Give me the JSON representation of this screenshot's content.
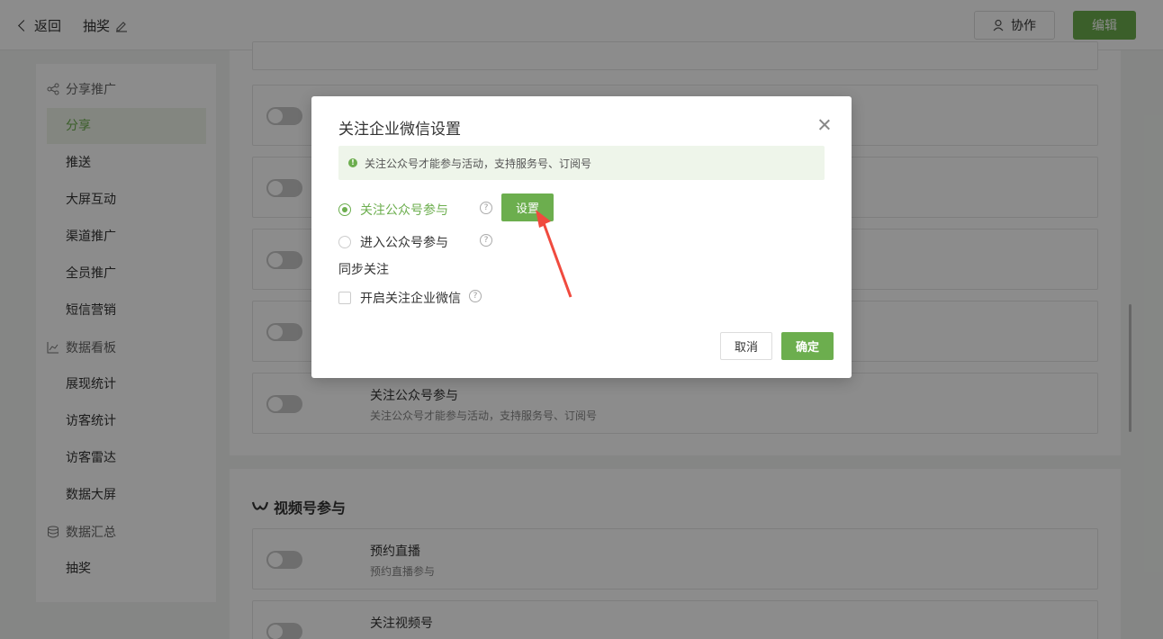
{
  "topbar": {
    "back_label": "返回",
    "page_title": "抽奖",
    "collab_label": "协作",
    "edit_label": "编辑"
  },
  "sidebar": {
    "sections": [
      {
        "label": "分享推广",
        "icon": "share-icon"
      },
      {
        "label": "数据看板",
        "icon": "chart-line-icon"
      },
      {
        "label": "数据汇总",
        "icon": "database-icon"
      }
    ],
    "items": [
      {
        "label": "分享",
        "active": true
      },
      {
        "label": "推送"
      },
      {
        "label": "大屏互动"
      },
      {
        "label": "渠道推广"
      },
      {
        "label": "全员推广"
      },
      {
        "label": "短信营销"
      },
      {
        "label": "展现统计"
      },
      {
        "label": "访客统计"
      },
      {
        "label": "访客雷达"
      },
      {
        "label": "数据大屏"
      },
      {
        "label": "抽奖"
      }
    ]
  },
  "main": {
    "cards": [
      {
        "title": "关注公众号参与",
        "desc": "关注公众号才能参与活动，支持服务号、订阅号"
      }
    ],
    "video_section": {
      "heading": "视频号参与",
      "cards": [
        {
          "title": "预约直播",
          "desc": "预约直播参与"
        },
        {
          "title": "关注视频号"
        }
      ]
    }
  },
  "modal": {
    "title": "关注企业微信设置",
    "tip": "关注公众号才能参与活动，支持服务号、订阅号",
    "options": [
      {
        "label": "关注公众号参与",
        "selected": true
      },
      {
        "label": "进入公众号参与",
        "selected": false
      }
    ],
    "set_label": "设置",
    "sync_label": "同步关注",
    "checkbox_label": "开启关注企业微信",
    "cancel_label": "取消",
    "ok_label": "确定"
  },
  "colors": {
    "accent": "#6cae4e",
    "arrow": "#f04a3e"
  }
}
